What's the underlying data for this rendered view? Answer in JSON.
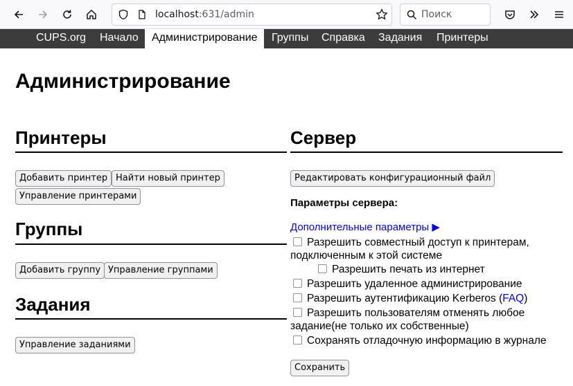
{
  "browser": {
    "url_host": "localhost",
    "url_rest": ":631/admin",
    "search_placeholder": "Поиск"
  },
  "nav": {
    "items": [
      "CUPS.org",
      "Начало",
      "Администрирование",
      "Группы",
      "Справка",
      "Задания",
      "Принтеры"
    ],
    "active": "Администрирование"
  },
  "page": {
    "title": "Администрирование"
  },
  "printers": {
    "heading": "Принтеры",
    "add_printer": "Добавить принтер",
    "find_printer": "Найти новый принтер",
    "manage_printers": "Управление принтерами"
  },
  "groups": {
    "heading": "Группы",
    "add_group": "Добавить группу",
    "manage_groups": "Управление группами"
  },
  "jobs": {
    "heading": "Задания",
    "manage_jobs": "Управление заданиями"
  },
  "server": {
    "heading": "Сервер",
    "edit_config": "Редактировать конфигурационный файл",
    "params_label": "Параметры сервера:",
    "advanced_link": "Дополнительные параметры ▶",
    "share_printers": "Разрешить совместный доступ к принтерам, подключенным к этой системе",
    "allow_internet": "Разрешить печать из интернет",
    "remote_admin": "Разрешить удаленное администрирование",
    "kerberos": "Разрешить аутентификацию Kerberos (",
    "kerberos_faq": "FAQ",
    "kerberos_end": ")",
    "cancel_jobs": "Разрешить пользователям отменять любое задание(не только их собственные)",
    "debug_log": "Сохранять отладочную информацию в журнале",
    "save": "Сохранить"
  }
}
